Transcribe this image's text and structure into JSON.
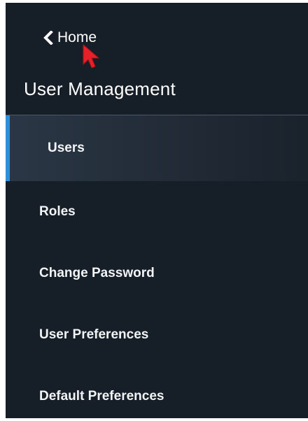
{
  "nav": {
    "back_label": "Home",
    "back_icon": "chevron-left-icon"
  },
  "section": {
    "title": "User Management"
  },
  "menu": {
    "items": [
      {
        "label": "Users",
        "active": true
      },
      {
        "label": "Roles",
        "active": false
      },
      {
        "label": "Change Password",
        "active": false
      },
      {
        "label": "User Preferences",
        "active": false
      },
      {
        "label": "Default Preferences",
        "active": false
      }
    ]
  },
  "colors": {
    "background": "#161e27",
    "active_accent": "#2f8fd8",
    "cursor": "#e8202a",
    "text": "#ffffff"
  }
}
